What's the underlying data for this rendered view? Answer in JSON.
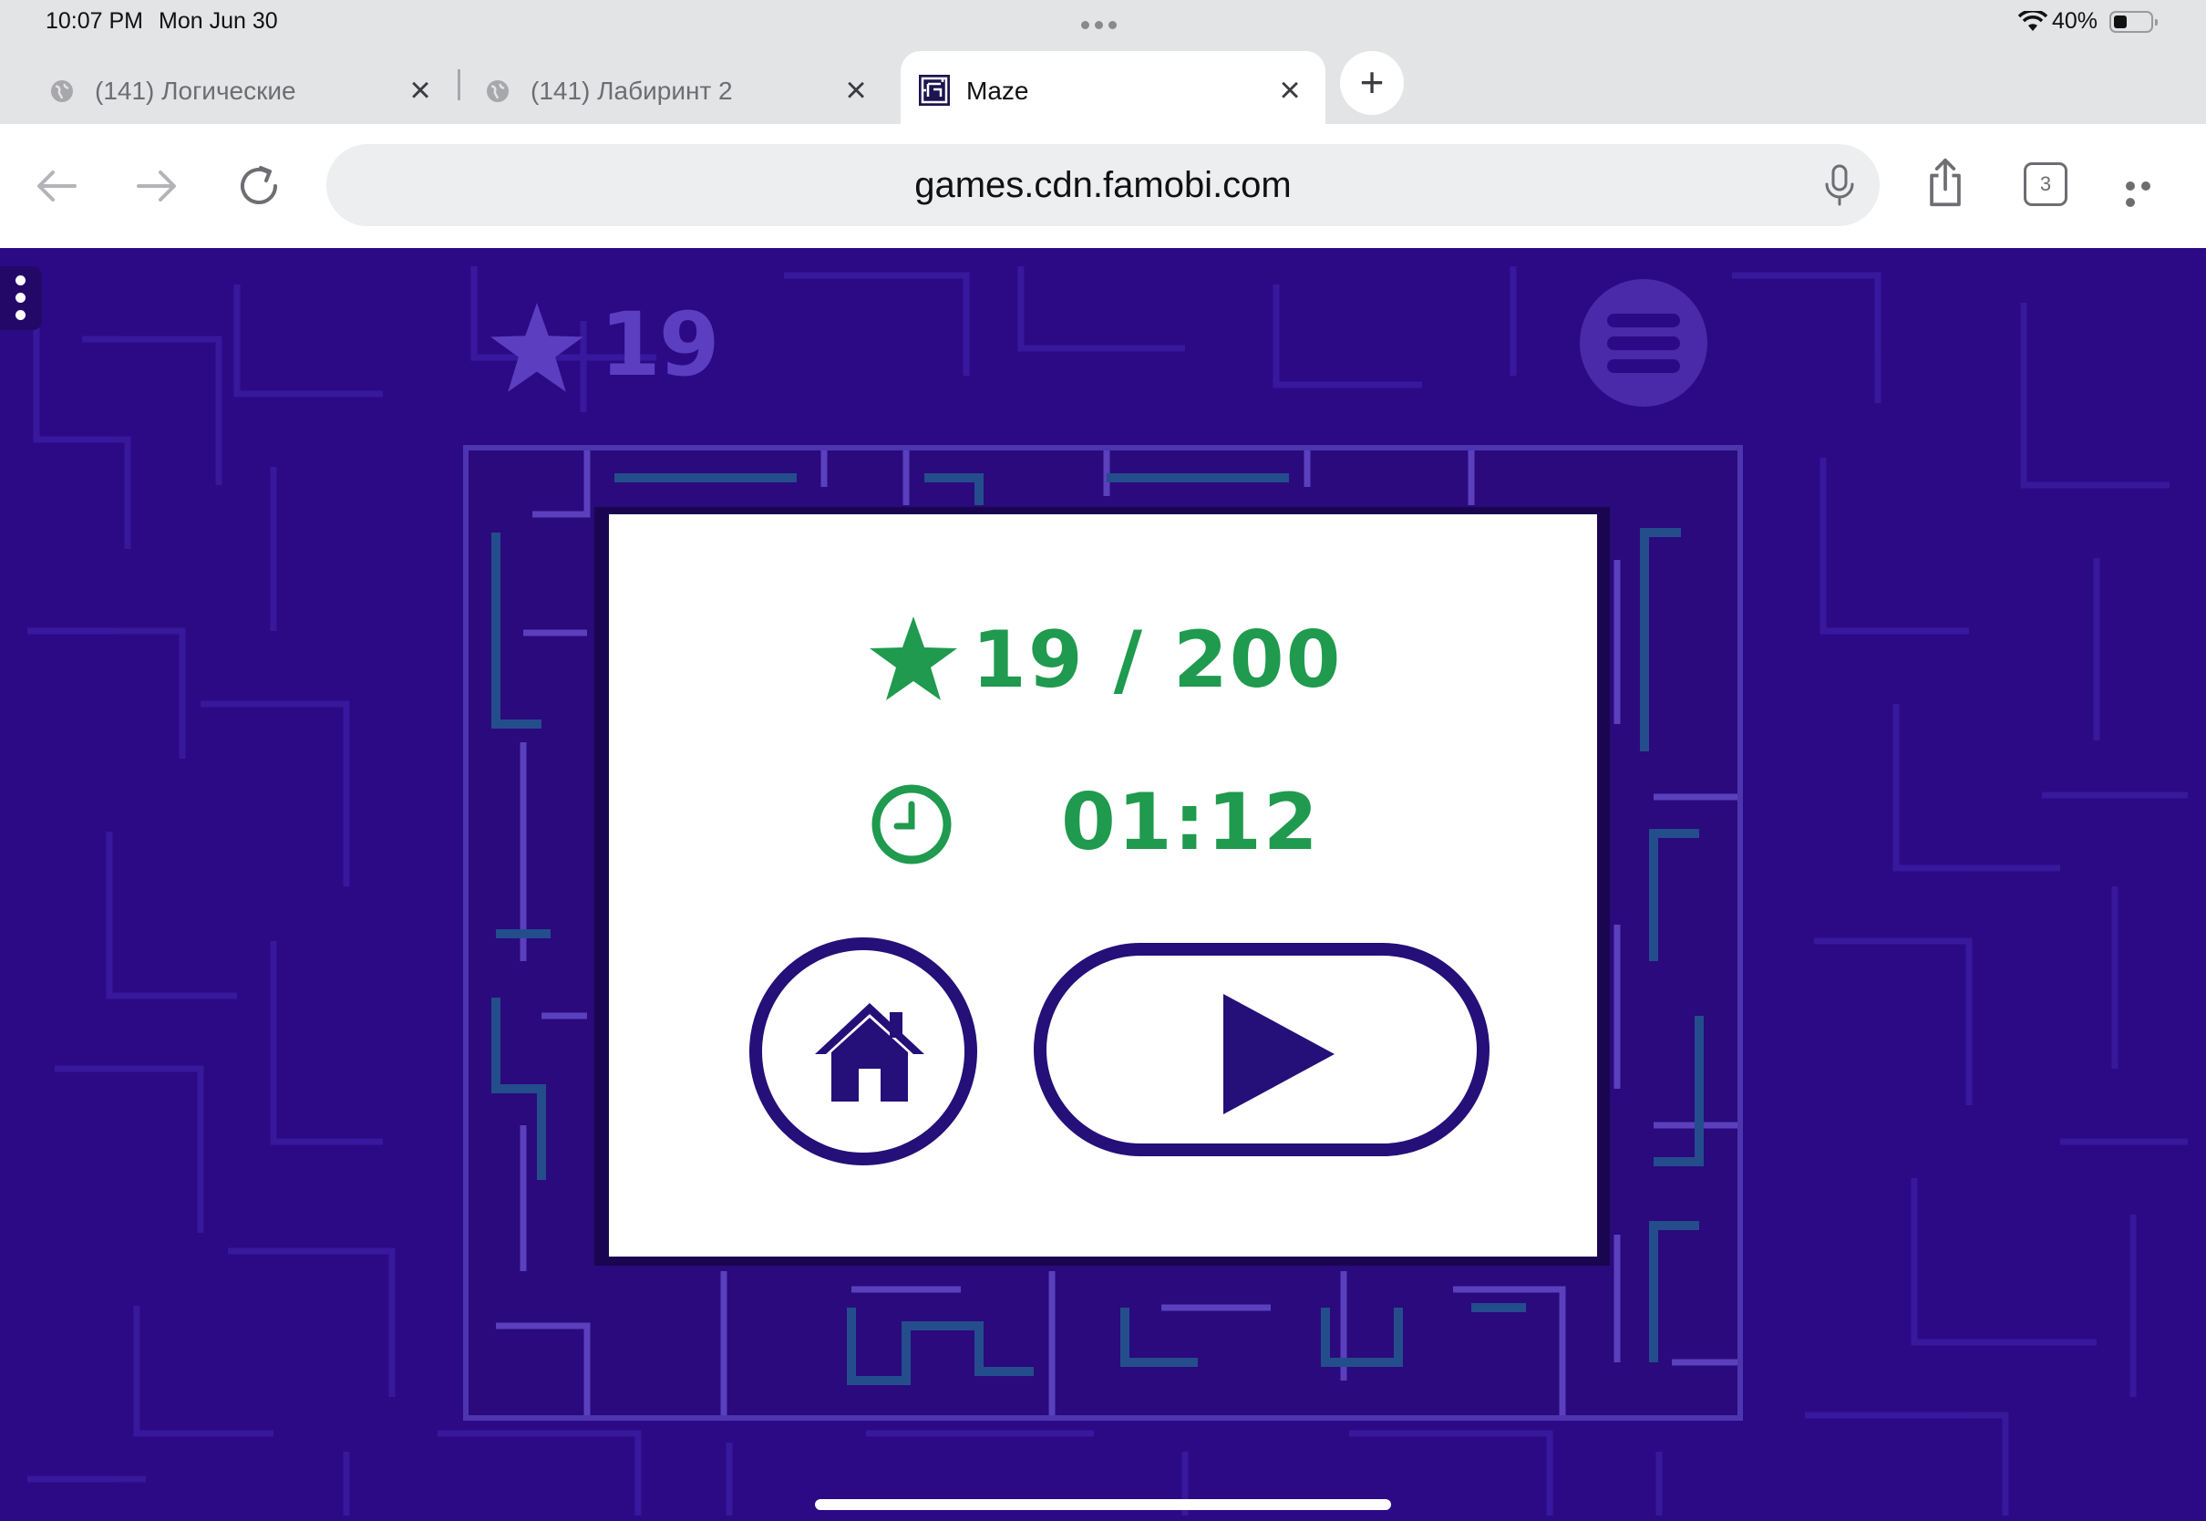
{
  "status_bar": {
    "time": "10:07 PM",
    "date": "Mon Jun 30",
    "battery_percent": "40%",
    "battery_level": 0.4
  },
  "tabs": [
    {
      "title": "(141) Логические",
      "active": false
    },
    {
      "title": "(141) Лабиринт 2",
      "active": false
    },
    {
      "title": "Maze",
      "active": true
    }
  ],
  "toolbar": {
    "url": "games.cdn.famobi.com",
    "tab_count": "3"
  },
  "game": {
    "hud": {
      "stars": "19"
    },
    "result_panel": {
      "stars_text": "19 / 200",
      "stars_collected": 19,
      "stars_total": 200,
      "time": "01:12"
    }
  },
  "colors": {
    "game_bg": "#2c0a86",
    "accent_green": "#1f9a4e",
    "button_navy": "#241078",
    "hud_purple": "#5b3fc0"
  },
  "icons": {
    "hud": [
      "star-icon",
      "hamburger-menu-icon"
    ],
    "panel": [
      "star-icon",
      "clock-icon",
      "home-icon",
      "play-icon"
    ],
    "browser": [
      "globe-icon",
      "close-icon",
      "plus-icon",
      "back-arrow-icon",
      "forward-arrow-icon",
      "reload-icon",
      "microphone-icon",
      "share-icon",
      "tabs-icon",
      "more-icon",
      "wifi-icon",
      "battery-icon"
    ]
  }
}
